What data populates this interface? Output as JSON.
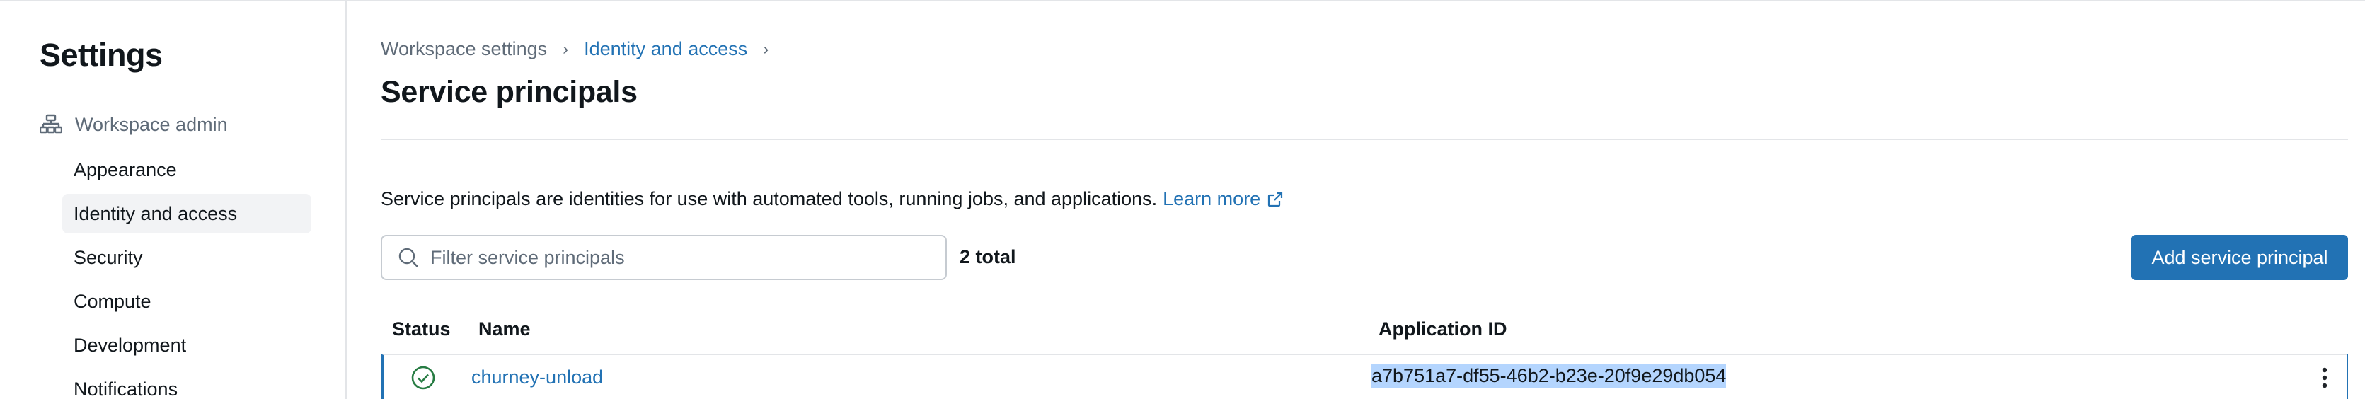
{
  "sidebar": {
    "title": "Settings",
    "section_label": "Workspace admin",
    "section_icon": "workspace-admin-icon",
    "items": [
      {
        "label": "Appearance"
      },
      {
        "label": "Identity and access",
        "active": true
      },
      {
        "label": "Security"
      },
      {
        "label": "Compute"
      },
      {
        "label": "Development"
      },
      {
        "label": "Notifications"
      }
    ]
  },
  "breadcrumb": {
    "items": [
      "Workspace settings",
      "Identity and access"
    ],
    "separator": "›"
  },
  "page": {
    "title": "Service principals",
    "description": "Service principals are identities for use with automated tools, running jobs, and applications.",
    "learn_more": "Learn more"
  },
  "toolbar": {
    "search_placeholder": "Filter service principals",
    "search_value": "",
    "total": "2 total",
    "add_label": "Add service principal"
  },
  "table": {
    "columns": [
      "Status",
      "Name",
      "Application ID"
    ],
    "rows": [
      {
        "status": "active",
        "status_icon": "check-circle-icon",
        "name": "churney-unload",
        "application_id": "a7b751a7-df55-46b2-b23e-20f9e29db054"
      }
    ]
  },
  "colors": {
    "accent": "#2272b4",
    "selection": "#b4d5fe",
    "status_ok": "#277c43"
  }
}
